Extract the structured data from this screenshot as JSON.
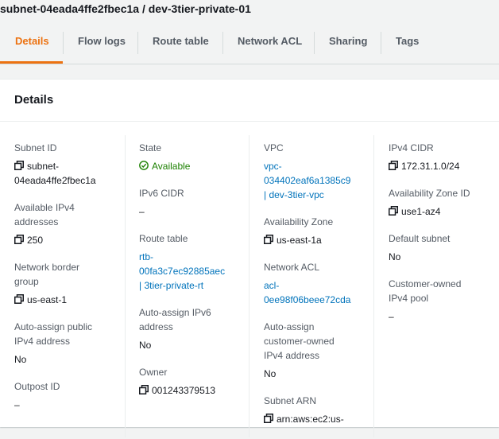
{
  "page_title": "subnet-04eada4ffe2fbec1a / dev-3tier-private-01",
  "tabs": [
    "Details",
    "Flow logs",
    "Route table",
    "Network ACL",
    "Sharing",
    "Tags"
  ],
  "panel_title": "Details",
  "col1": {
    "subnet_id_label": "Subnet ID",
    "subnet_id_1": "subnet-",
    "subnet_id_2": "04eada4ffe2fbec1a",
    "ipv4_label_1": "Available IPv4",
    "ipv4_label_2": "addresses",
    "ipv4_value": "250",
    "nbg_label_1": "Network border",
    "nbg_label_2": "group",
    "nbg_value": "us-east-1",
    "aapub_label_1": "Auto-assign public",
    "aapub_label_2": "IPv4 address",
    "aapub_value": "No",
    "outpost_label": "Outpost ID",
    "outpost_value": "–"
  },
  "col2": {
    "state_label": "State",
    "state_value": "Available",
    "ipv6_label": "IPv6 CIDR",
    "ipv6_value": "–",
    "rt_label": "Route table",
    "rt_1": "rtb-",
    "rt_2": "00fa3c7ec92885aec",
    "rt_3": "| 3tier-private-rt",
    "aa6_label_1": "Auto-assign IPv6",
    "aa6_label_2": "address",
    "aa6_value": "No",
    "owner_label": "Owner",
    "owner_value": "001243379513"
  },
  "col3": {
    "vpc_label": "VPC",
    "vpc_1": "vpc-",
    "vpc_2": "034402eaf6a1385c9",
    "vpc_3": "| dev-3tier-vpc",
    "az_label": "Availability Zone",
    "az_value": "us-east-1a",
    "nacl_label": "Network ACL",
    "nacl_1": "acl-",
    "nacl_2": "0ee98f06beee72cda",
    "aaco_label_1": "Auto-assign",
    "aaco_label_2": "customer-owned",
    "aaco_label_3": "IPv4 address",
    "aaco_value": "No",
    "arn_label": "Subnet ARN",
    "arn_value": "arn:aws:ec2:us-"
  },
  "col4": {
    "cidr_label": "IPv4 CIDR",
    "cidr_value": "172.31.1.0/24",
    "azid_label": "Availability Zone ID",
    "azid_value": "use1-az4",
    "default_label": "Default subnet",
    "default_value": "No",
    "co_label_1": "Customer-owned",
    "co_label_2": "IPv4 pool",
    "co_value": "–"
  },
  "colors": {
    "accent": "#ec7211",
    "link": "#0073bb",
    "success": "#1d8102"
  }
}
